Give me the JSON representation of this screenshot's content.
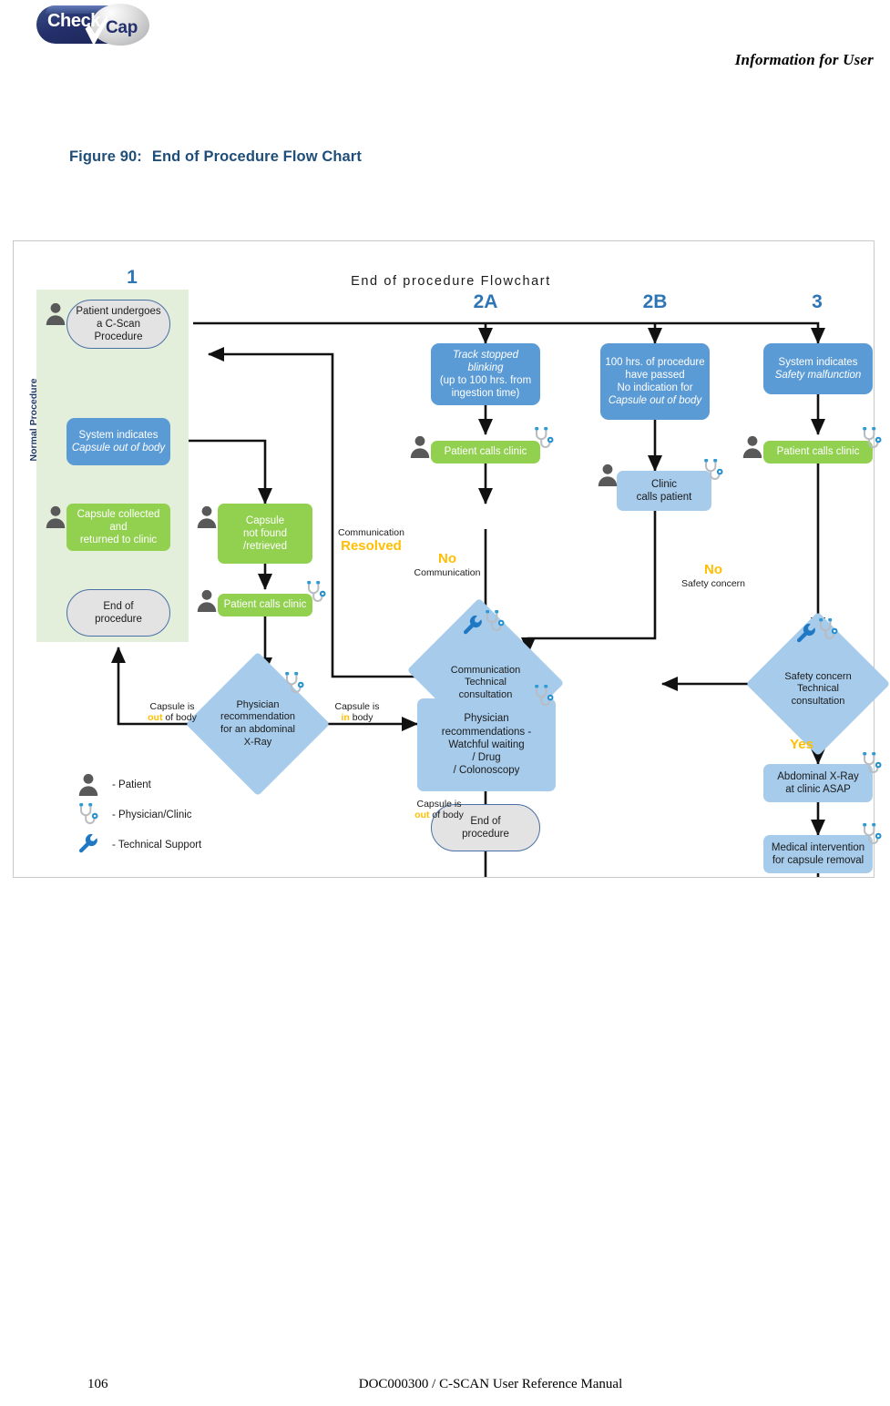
{
  "header": {
    "logo": {
      "brand_part1": "Check",
      "brand_part2": "Cap",
      "name": "checkcap-logo"
    },
    "title": "Information for User"
  },
  "figure": {
    "number": "Figure 90:",
    "caption": "End of Procedure Flow Chart"
  },
  "chart_data": {
    "type": "diagram",
    "title": "End of procedure Flowchart",
    "lane_label": "Normal Procedure",
    "columns": [
      {
        "id": "1",
        "label": "1"
      },
      {
        "id": "2A",
        "label": "2A"
      },
      {
        "id": "2B",
        "label": "2B"
      },
      {
        "id": "3",
        "label": "3"
      }
    ],
    "nodes": [
      {
        "id": "n1",
        "column": "1",
        "shape": "terminator",
        "text": "Patient undergoes\na C-Scan Procedure",
        "line1": "Patient undergoes",
        "line2": "a C-Scan Procedure",
        "role": "patient",
        "color": "#e3e3e3"
      },
      {
        "id": "n2",
        "column": "1",
        "shape": "rect",
        "line1": "System indicates",
        "line2": "Capsule out of body",
        "line2_italic": true,
        "role": "",
        "color": "#5b9bd5"
      },
      {
        "id": "n3",
        "column": "1",
        "shape": "rect",
        "line1": "Capsule collected and",
        "line2": "returned to clinic",
        "role": "patient",
        "color": "#92d050"
      },
      {
        "id": "n4",
        "column": "1",
        "shape": "terminator",
        "line1": "End of",
        "line2": "procedure",
        "role": "",
        "color": "#e3e3e3"
      },
      {
        "id": "n5",
        "column": "1b",
        "shape": "rect",
        "line1": "Capsule",
        "line2": "not found",
        "line3": "/retrieved",
        "role": "patient",
        "color": "#92d050"
      },
      {
        "id": "n6",
        "column": "1b",
        "shape": "rect",
        "line1": "Patient calls clinic",
        "role": "patient-physician",
        "color": "#92d050"
      },
      {
        "id": "n7",
        "column": "1b",
        "shape": "diamond",
        "line1": "Physician",
        "line2": "recommendation",
        "line3": "for an abdominal",
        "line4": "X-Ray",
        "role": "physician",
        "color": "#a6cbeb"
      },
      {
        "id": "n8",
        "column": "2A",
        "shape": "rect",
        "line1": "Track stopped blinking",
        "line1_italic": true,
        "line2": "(up to 100 hrs. from",
        "line3": "ingestion time)",
        "role": "",
        "color": "#5b9bd5"
      },
      {
        "id": "n9",
        "column": "2A",
        "shape": "rect",
        "line1": "Patient calls clinic",
        "role": "patient-physician",
        "color": "#92d050"
      },
      {
        "id": "n10",
        "column": "2A",
        "shape": "diamond",
        "line1": "Communication",
        "line2": "Technical",
        "line3": "consultation",
        "role": "tech-physician",
        "color": "#a6cbeb"
      },
      {
        "id": "n11",
        "column": "2A",
        "shape": "rect",
        "line1": "Physician",
        "line2": "recommendations -",
        "line3": "Watchful waiting",
        "line4": "/ Drug",
        "line5": "/ Colonoscopy",
        "role": "physician",
        "color": "#a6cbeb"
      },
      {
        "id": "n12",
        "column": "2A",
        "shape": "terminator",
        "line1": "End of",
        "line2": "procedure",
        "role": "",
        "color": "#e3e3e3"
      },
      {
        "id": "n13",
        "column": "2B",
        "shape": "rect",
        "line1": "100 hrs. of procedure",
        "line2": "have passed",
        "line3": "No indication for",
        "line4": "Capsule out of body",
        "line4_italic": true,
        "role": "",
        "color": "#5b9bd5"
      },
      {
        "id": "n14",
        "column": "2B",
        "shape": "rect",
        "line1": "Clinic",
        "line2": "calls patient",
        "role": "patient-physician",
        "color": "#a6cbeb"
      },
      {
        "id": "n15",
        "column": "3",
        "shape": "rect",
        "line1": "System indicates",
        "line2": "Safety malfunction",
        "line2_italic": true,
        "role": "",
        "color": "#5b9bd5"
      },
      {
        "id": "n16",
        "column": "3",
        "shape": "rect",
        "line1": "Patient calls clinic",
        "role": "patient-physician",
        "color": "#92d050"
      },
      {
        "id": "n17",
        "column": "3",
        "shape": "diamond",
        "line1": "Safety concern",
        "line2": "Technical",
        "line3": "consultation",
        "role": "tech-physician",
        "color": "#a6cbeb"
      },
      {
        "id": "n18",
        "column": "3",
        "shape": "rect",
        "line1": "Abdominal X-Ray",
        "line2": "at clinic ASAP",
        "role": "physician",
        "color": "#a6cbeb"
      },
      {
        "id": "n19",
        "column": "3",
        "shape": "rect",
        "line1": "Medical intervention",
        "line2": "for capsule removal",
        "role": "physician",
        "color": "#a6cbeb"
      }
    ],
    "edge_labels": [
      {
        "id": "e1",
        "plain": "Communication",
        "highlight": "Resolved",
        "layout": "stacked-below"
      },
      {
        "id": "e2",
        "highlight_big": "No",
        "plain": "Communication",
        "layout": "stacked"
      },
      {
        "id": "e3",
        "highlight_big": "No",
        "plain": "Safety concern",
        "layout": "stacked"
      },
      {
        "id": "e4",
        "highlight_big": "Yes",
        "layout": "single"
      },
      {
        "id": "e5",
        "plain": "Capsule is",
        "highlight": "out",
        "suffix": " of body",
        "layout": "two-line"
      },
      {
        "id": "e6",
        "plain": "Capsule is",
        "highlight": "in",
        "suffix": " body",
        "layout": "two-line"
      },
      {
        "id": "e7",
        "plain": "Capsule is",
        "highlight": "out",
        "suffix": " of body",
        "layout": "two-line"
      }
    ],
    "legend": [
      {
        "icon": "patient-icon",
        "label": "- Patient"
      },
      {
        "icon": "stethoscope-icon",
        "label": "- Physician/Clinic"
      },
      {
        "icon": "wrench-icon",
        "label": "- Technical Support"
      }
    ],
    "colors": {
      "blue": "#5b9bd5",
      "green": "#92d050",
      "light_blue": "#a6cbeb",
      "terminator_grey": "#e3e3e3",
      "lane_green": "#e3efda",
      "accent_yellow": "#ffbf00",
      "column_number_blue": "#2e75b6",
      "caption_blue": "#1f4e79"
    }
  },
  "footer": {
    "page_number": "106",
    "document": "DOC000300 / C-SCAN User Reference Manual"
  }
}
